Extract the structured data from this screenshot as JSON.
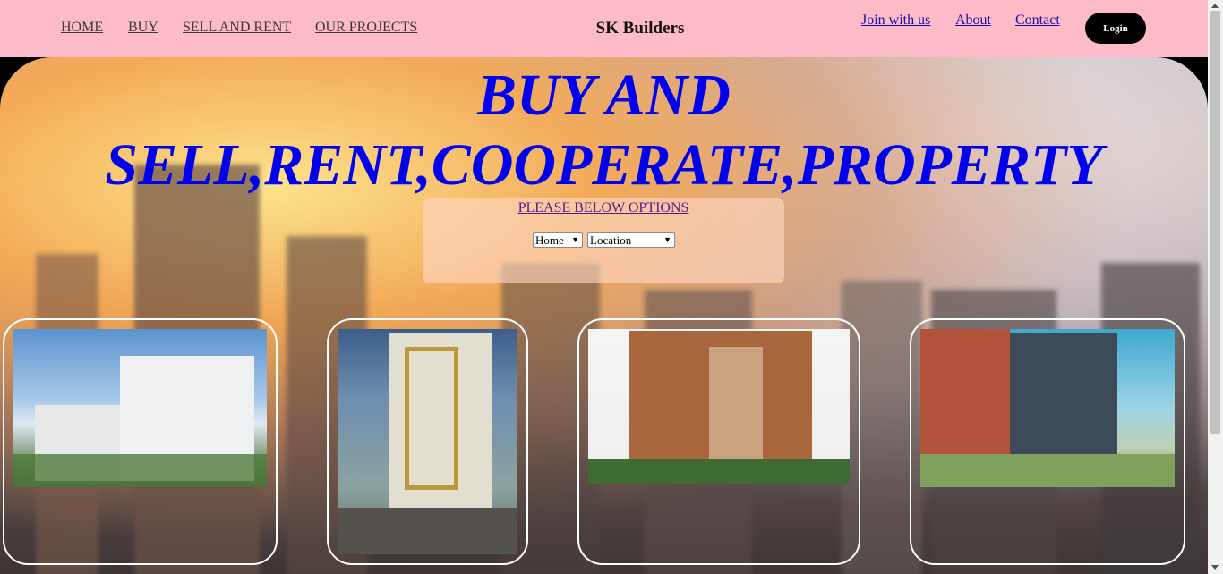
{
  "nav": {
    "left": [
      "HOME",
      "BUY",
      "SELL AND RENT",
      "OUR PROJECTS"
    ],
    "brand": "SK Builders",
    "right": [
      "Join with us",
      "About",
      "Contact"
    ],
    "login": "Login"
  },
  "hero": {
    "headline_line1": "BUY AND",
    "headline_line2": "SELL,RENT,COOPERATE,PROPERTY",
    "options_link": "PLEASE BELOW OPTIONS",
    "type_select": "Home",
    "location_select": "Location"
  },
  "colors": {
    "navbar": "#fdbac7",
    "headline": "#0000ee",
    "login_bg": "#000000"
  }
}
